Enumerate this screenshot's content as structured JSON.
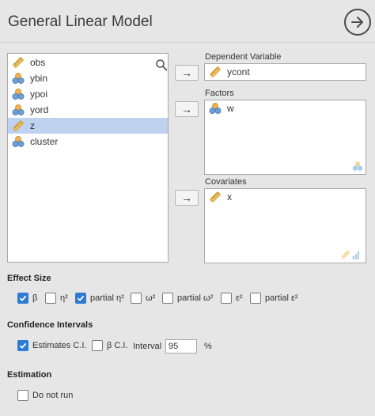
{
  "header": {
    "title": "General Linear Model",
    "nav_icon": "arrow-right-circle-icon"
  },
  "variables": {
    "items": [
      {
        "label": "obs",
        "icon": "continuous-ruler-icon",
        "selected": false
      },
      {
        "label": "ybin",
        "icon": "nominal-circles-icon",
        "selected": false
      },
      {
        "label": "ypoi",
        "icon": "nominal-circles-icon",
        "selected": false
      },
      {
        "label": "yord",
        "icon": "nominal-circles-icon",
        "selected": false
      },
      {
        "label": "z",
        "icon": "continuous-ruler-icon",
        "selected": true
      },
      {
        "label": "cluster",
        "icon": "nominal-circles-icon",
        "selected": false
      }
    ]
  },
  "targets": {
    "dependent": {
      "label": "Dependent Variable",
      "value": "ycont"
    },
    "factors": {
      "label": "Factors",
      "items": [
        "w"
      ]
    },
    "covariates": {
      "label": "Covariates",
      "items": [
        "x"
      ]
    },
    "arrow": "→"
  },
  "effect_size": {
    "title": "Effect Size",
    "options": [
      {
        "label": "β",
        "checked": true
      },
      {
        "label": "η²",
        "checked": false
      },
      {
        "label": "partial η²",
        "checked": true
      },
      {
        "label": "ω²",
        "checked": false
      },
      {
        "label": "partial ω²",
        "checked": false
      },
      {
        "label": "ε²",
        "checked": false
      },
      {
        "label": "partial ε²",
        "checked": false
      }
    ]
  },
  "confidence_intervals": {
    "title": "Confidence Intervals",
    "estimates_label": "Estimates C.I.",
    "estimates_checked": true,
    "beta_label": "β C.I.",
    "beta_checked": false,
    "interval_label": "Interval",
    "interval_value": "95",
    "interval_unit": "%"
  },
  "estimation": {
    "title": "Estimation",
    "do_not_run_label": "Do not run",
    "do_not_run_checked": false
  },
  "colors": {
    "selection": "#bfd3f0",
    "checkbox": "#2d7bd4",
    "ruler": "#f0c060",
    "nominal_blue": "#6d9fd8",
    "nominal_orange": "#f0b050"
  }
}
